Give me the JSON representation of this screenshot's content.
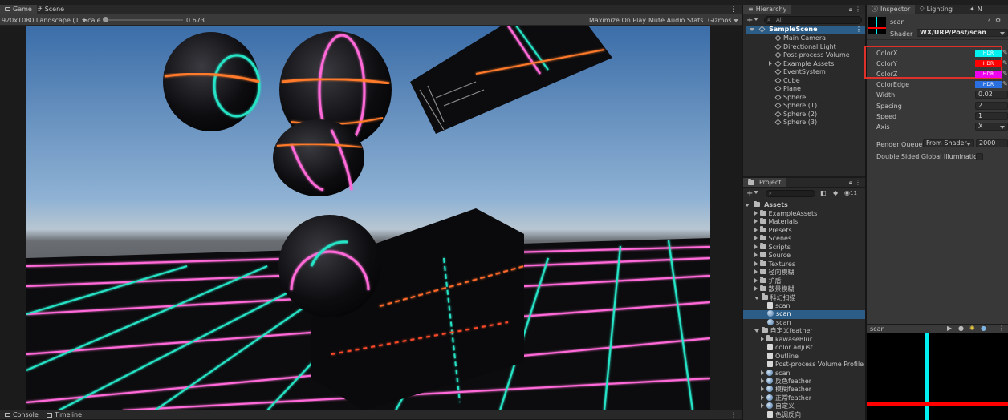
{
  "game_tabs": {
    "game": "Game",
    "scene": "Scene"
  },
  "game_toolbar": {
    "resolution": "920x1080 Landscape (1",
    "scale_label": "Scale",
    "scale_value": "0.673",
    "maximize": "Maximize On Play",
    "mute": "Mute Audio",
    "stats": "Stats",
    "gizmos": "Gizmos"
  },
  "bottom_tabs": {
    "console": "Console",
    "timeline": "Timeline"
  },
  "hierarchy": {
    "tab": "Hierarchy",
    "search_placeholder": "All",
    "scene": "SampleScene",
    "items": [
      "Main Camera",
      "Directional Light",
      "Post-process Volume",
      "Example Assets",
      "EventSystem",
      "Cube",
      "Plane",
      "Sphere",
      "Sphere (1)",
      "Sphere (2)",
      "Sphere (3)"
    ]
  },
  "project": {
    "tab": "Project",
    "count": "11",
    "root": "Assets",
    "folders": [
      "ExampleAssets",
      "Materials",
      "Presets",
      "Scenes",
      "Scripts",
      "Source",
      "Textures",
      "径向模糊",
      "护盾",
      "散景模糊",
      "科幻扫描"
    ],
    "scan_children": [
      "scan",
      "scan",
      "scan"
    ],
    "feather_folder": "自定义feather",
    "feather_children": [
      "kawaseBlur",
      "color adjust",
      "Outline",
      "Post-process Volume Profile",
      "scan",
      "反色feather",
      "模糊feather",
      "正常feather",
      "自定义",
      "色调反向"
    ]
  },
  "inspector": {
    "tabs": {
      "inspector": "Inspector",
      "lighting": "Lighting",
      "more": "N"
    },
    "material_name": "scan",
    "shader_label": "Shader",
    "shader_value": "WX/URP/Post/scan",
    "props": [
      {
        "label": "ColorX",
        "kind": "color",
        "color": "#00f0f0",
        "badge": "HDR"
      },
      {
        "label": "ColorY",
        "kind": "color",
        "color": "#ff0000",
        "badge": "HDR"
      },
      {
        "label": "ColorZ",
        "kind": "color",
        "color": "#ee00ee",
        "badge": "HDR"
      },
      {
        "label": "ColorEdge",
        "kind": "color",
        "color": "#2a6fe0",
        "badge": "HDR"
      },
      {
        "label": "Width",
        "kind": "value",
        "value": "0.02"
      },
      {
        "label": "Spacing",
        "kind": "value",
        "value": "2"
      },
      {
        "label": "Speed",
        "kind": "value",
        "value": "1"
      },
      {
        "label": "Axis",
        "kind": "dropdown",
        "value": "X"
      }
    ],
    "render_queue_label": "Render Queue",
    "render_queue_mode": "From Shader",
    "render_queue_value": "2000",
    "double_sided_label": "Double Sided Global Illumination",
    "preview_name": "scan"
  },
  "colors": {
    "highlight": "#e0302a",
    "selection": "#2c5d87",
    "cyan": "#00f0f0",
    "red": "#ff0000"
  }
}
